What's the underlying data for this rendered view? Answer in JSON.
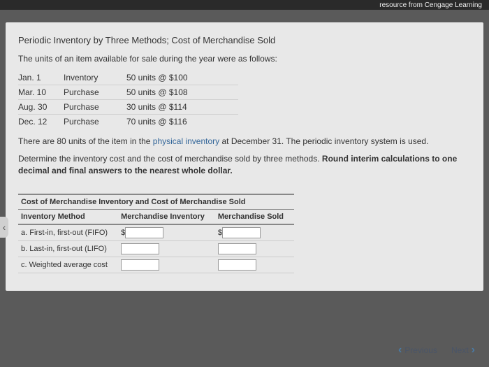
{
  "topbar": "resource from Cengage Learning",
  "title": "Periodic Inventory by Three Methods; Cost of Merchandise Sold",
  "intro": "The units of an item available for sale during the year were as follows:",
  "rows": [
    {
      "date": "Jan. 1",
      "type": "Inventory",
      "detail": "50 units @ $100"
    },
    {
      "date": "Mar. 10",
      "type": "Purchase",
      "detail": "50 units @ $108"
    },
    {
      "date": "Aug. 30",
      "type": "Purchase",
      "detail": "30 units @ $114"
    },
    {
      "date": "Dec. 12",
      "type": "Purchase",
      "detail": "70 units @ $116"
    }
  ],
  "desc1_a": "There are 80 units of the item in the ",
  "desc1_link": "physical inventory",
  "desc1_b": " at December 31. The periodic inventory system is used.",
  "desc2_a": "Determine the inventory cost and the cost of merchandise sold by three methods. ",
  "desc2_bold": "Round interim calculations to one decimal and final answers to the nearest whole dollar.",
  "section_header": "Cost of Merchandise Inventory and Cost of Merchandise Sold",
  "col1": "Inventory Method",
  "col2": "Merchandise Inventory",
  "col3": "Merchandise Sold",
  "methods": {
    "a": "a. First-in, first-out (FIFO)",
    "b": "b. Last-in, first-out (LIFO)",
    "c": "c. Weighted average cost"
  },
  "dollar": "$",
  "nav": {
    "prev": "Previous",
    "next": "Next"
  }
}
